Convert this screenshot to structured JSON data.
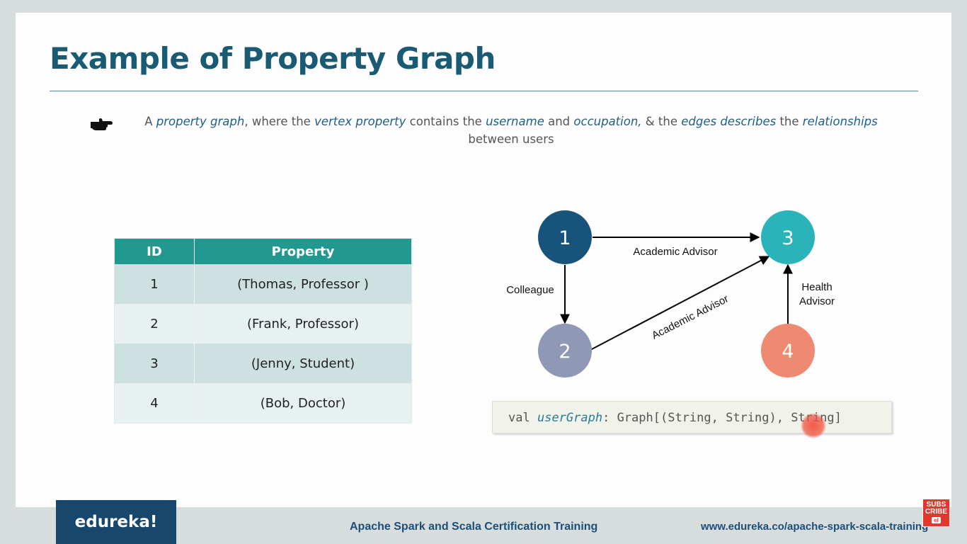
{
  "slide": {
    "title": "Example of Property Graph",
    "description": {
      "p1": "A ",
      "e1": "property graph",
      "p2": ", where the ",
      "e2": "vertex property",
      "p3": " contains the ",
      "e3": "username",
      "p4": " and ",
      "e4": "occupation,",
      "p5": " & the ",
      "e5": "edges describes",
      "p6": " the ",
      "e6": "relationships",
      "line2": "between users"
    },
    "table": {
      "headers": [
        "ID",
        "Property"
      ],
      "rows": [
        [
          "1",
          "(Thomas, Professor )"
        ],
        [
          "2",
          "(Frank, Professor)"
        ],
        [
          "3",
          "(Jenny, Student)"
        ],
        [
          "4",
          "(Bob, Doctor)"
        ]
      ]
    },
    "graph": {
      "nodes": [
        {
          "id": "1",
          "color": "#17537a"
        },
        {
          "id": "2",
          "color": "#8f98b4"
        },
        {
          "id": "3",
          "color": "#2ab3b8"
        },
        {
          "id": "4",
          "color": "#ee8a72"
        }
      ],
      "edges": [
        {
          "from": "1",
          "to": "3",
          "label": "Academic Advisor"
        },
        {
          "from": "1",
          "to": "2",
          "label": "Colleague"
        },
        {
          "from": "2",
          "to": "3",
          "label": "Academic Advisor"
        },
        {
          "from": "4",
          "to": "3",
          "label_line1": "Health",
          "label_line2": "Advisor"
        }
      ]
    },
    "code": {
      "keyword": "val",
      "variable": "userGraph",
      "rest": ": Graph[(String, String), String]"
    }
  },
  "footer": {
    "logo": "edureka!",
    "course": "Apache Spark and Scala Certification Training",
    "url": "www.edureka.co/apache-spark-scala-training",
    "subscribe_line1": "SUBS",
    "subscribe_line2": "CRIBE",
    "subscribe_mini": "el"
  },
  "colors": {
    "title": "#1a5b74",
    "table_header": "#22998f",
    "emphasis": "#1f5f85",
    "footer_bg": "#17476c"
  }
}
